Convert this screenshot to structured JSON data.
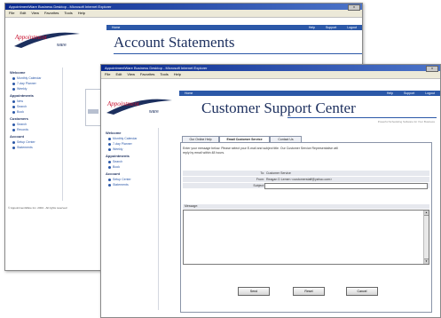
{
  "window_back": {
    "title": "AppointmentWare Business Desktop - Microsoft Internet Explorer",
    "menu": [
      "File",
      "Edit",
      "View",
      "Favorites",
      "Tools",
      "Help"
    ],
    "home_link": "Home",
    "top_links": [
      "Help",
      "Support",
      "Logout"
    ],
    "page_title": "Account Statements",
    "sidebar": [
      {
        "section": "Welcome",
        "items": [
          "Monthly Calendar",
          "7-day Planner",
          "Weekly"
        ]
      },
      {
        "section": "Appointments",
        "items": [
          "New",
          "Search",
          "Book"
        ]
      },
      {
        "section": "Customers",
        "items": [
          "Search",
          "Records"
        ]
      },
      {
        "section": "Account",
        "items": [
          "Setup Center",
          "Statements"
        ]
      }
    ],
    "footer": "© AppointmentWare Inc. 2004 - All rights reserved"
  },
  "window_front": {
    "title": "AppointmentWare Business Desktop - Microsoft Internet Explorer",
    "menu": [
      "File",
      "Edit",
      "View",
      "Favorites",
      "Tools",
      "Help"
    ],
    "home_link": "Home",
    "top_links": [
      "Help",
      "Support",
      "Logout"
    ],
    "logo_text": "Appointment",
    "logo_sub": "ware",
    "page_title": "Customer Support Center",
    "tagline": "Powerful Scheduling Software for Your Business",
    "sidebar": [
      {
        "section": "Welcome",
        "items": [
          "Monthly Calendar",
          "7-day Planner",
          "Weekly"
        ]
      },
      {
        "section": "Appointments",
        "items": [
          "Search",
          "Book"
        ]
      },
      {
        "section": "Account",
        "items": [
          "Setup Center",
          "Statements"
        ]
      }
    ],
    "tabs": [
      "Our Online Help",
      "Email Customer Service",
      "Contact Us"
    ],
    "intro_line1": "Enter your message below. Please select your E-mail and subject title. Our Customer Service Representative will",
    "intro_line2": "reply by email within 48 hours.",
    "form": {
      "to_label": "To:",
      "to_value": "Customer Service",
      "from_label": "From:",
      "from_value": "Reagan D Lemen <customerstaff@yahoo.com>",
      "subject_label": "Subject:",
      "subject_value": "",
      "message_label": "Message:"
    },
    "buttons": [
      "Send",
      "Reset",
      "Cancel"
    ]
  },
  "colors": {
    "nav_blue": "#2b58a8",
    "title_navy": "#1c2f5e",
    "logo_red": "#c8102e"
  }
}
